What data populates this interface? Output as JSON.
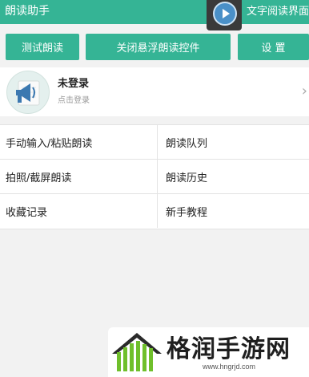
{
  "app": {
    "title": "朗读助手",
    "right_title": "文字阅读界面"
  },
  "toolbar": {
    "test_read": "测试朗读",
    "close_float": "关闭悬浮朗读控件",
    "settings": "设 置"
  },
  "profile": {
    "name": "未登录",
    "hint": "点击登录",
    "chevron": "›"
  },
  "menu": [
    {
      "label": "手动输入/粘贴朗读"
    },
    {
      "label": "朗读队列"
    },
    {
      "label": "拍照/截屏朗读"
    },
    {
      "label": "朗读历史"
    },
    {
      "label": "收藏记录"
    },
    {
      "label": "新手教程"
    }
  ],
  "watermark": {
    "brand": "格润手游网",
    "url": "www.hngrjd.com"
  },
  "colors": {
    "accent": "#35b495",
    "background": "#f2f2f2",
    "play": "#4a90c8"
  },
  "icons": {
    "play": "play-icon",
    "avatar": "megaphone-icon",
    "logo": "house-logo-icon"
  }
}
